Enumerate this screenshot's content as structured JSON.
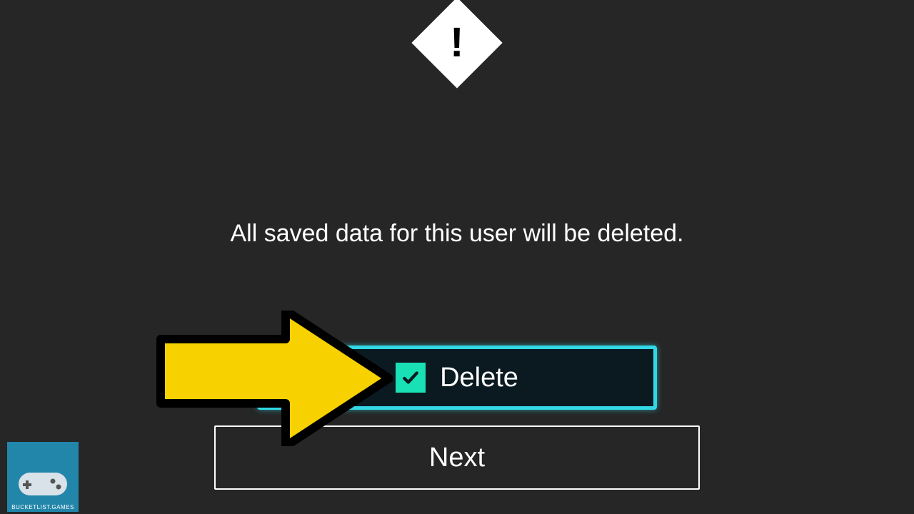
{
  "dialog": {
    "message": "All saved data for this user will be deleted.",
    "delete_label": "Delete",
    "next_label": "Next"
  },
  "watermark": {
    "label": "BUCKETLIST.GAMES"
  },
  "colors": {
    "accent": "#32d8e6",
    "checkbox": "#19e0b5",
    "arrow": "#f7d100",
    "watermark_bg": "#2286aa"
  }
}
